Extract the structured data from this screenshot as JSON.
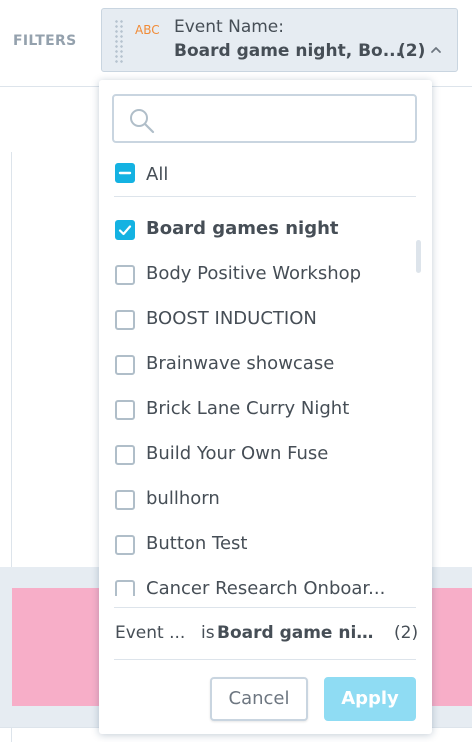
{
  "topbar": {
    "filters_label": "FILTERS",
    "chip": {
      "type": "ABC",
      "name": "Event Name:",
      "value": "Board game night, Bo...",
      "count": "(2)",
      "arrow_icon": "chevron-up-icon"
    }
  },
  "dropdown": {
    "search": {
      "placeholder": "",
      "value": "",
      "icon": "search-icon"
    },
    "all": {
      "label": "All",
      "state": "partial"
    },
    "items": [
      {
        "label": "Board games night",
        "checked": true
      },
      {
        "label": "Body Positive Workshop",
        "checked": false
      },
      {
        "label": "BOOST INDUCTION",
        "checked": false
      },
      {
        "label": "Brainwave showcase",
        "checked": false
      },
      {
        "label": "Brick Lane Curry Night",
        "checked": false
      },
      {
        "label": "Build Your Own Fuse",
        "checked": false
      },
      {
        "label": "bullhorn",
        "checked": false
      },
      {
        "label": "Button Test",
        "checked": false
      },
      {
        "label": "Cancer Research Onboar...",
        "checked": false
      }
    ],
    "summary": {
      "key": "Event ...",
      "is": "is",
      "value": "Board game nig...",
      "count": "(2)"
    },
    "buttons": {
      "cancel": "Cancel",
      "apply": "Apply"
    }
  },
  "colors": {
    "accent": "#14b2e2",
    "apply_disabled": "#8fdcf3",
    "type_badge": "#f18b37",
    "bar_pink": "#f7aec8"
  }
}
